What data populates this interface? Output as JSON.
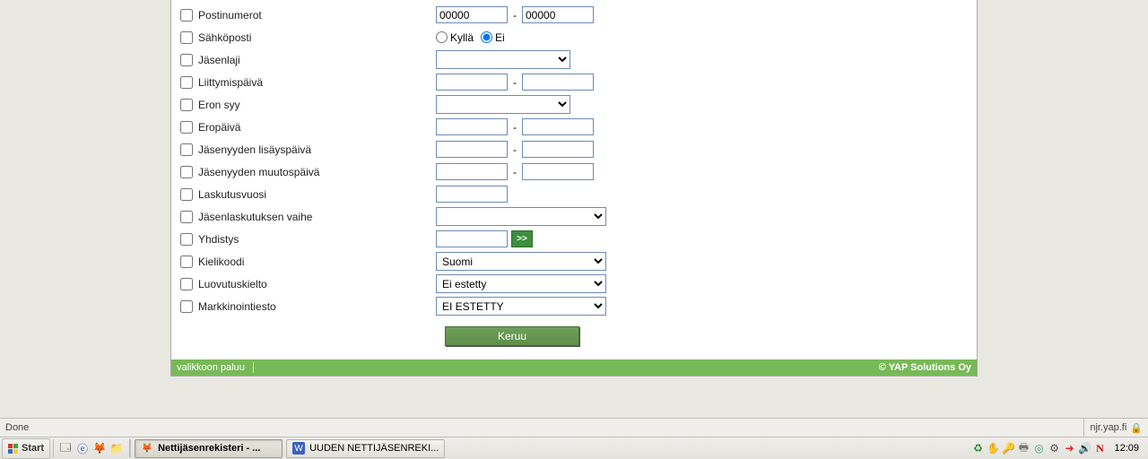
{
  "form": {
    "rows": [
      {
        "key": "postinumerot",
        "label": "Postinumerot",
        "type": "text-range",
        "v1": "00000",
        "v2": "00000"
      },
      {
        "key": "sahkoposti",
        "label": "Sähköposti",
        "type": "radio",
        "opt1": "Kyllä",
        "opt2": "Ei",
        "selected": 2
      },
      {
        "key": "jasenlaji",
        "label": "Jäsenlaji",
        "type": "select",
        "value": ""
      },
      {
        "key": "liittymispaiva",
        "label": "Liittymispäivä",
        "type": "text-range",
        "v1": "",
        "v2": ""
      },
      {
        "key": "eronsyy",
        "label": "Eron syy",
        "type": "select-narrow",
        "value": ""
      },
      {
        "key": "eropaiva",
        "label": "Eropäivä",
        "type": "text-range",
        "v1": "",
        "v2": ""
      },
      {
        "key": "lisayspaiva",
        "label": "Jäsenyyden lisäyspäivä",
        "type": "text-range",
        "v1": "",
        "v2": ""
      },
      {
        "key": "muutospaiva",
        "label": "Jäsenyyden muutospäivä",
        "type": "text-range",
        "v1": "",
        "v2": ""
      },
      {
        "key": "laskutusvuosi",
        "label": "Laskutusvuosi",
        "type": "text-single",
        "v1": ""
      },
      {
        "key": "laskvaihe",
        "label": "Jäsenlaskutuksen vaihe",
        "type": "select-wide",
        "value": ""
      },
      {
        "key": "yhdistys",
        "label": "Yhdistys",
        "type": "text-go",
        "v1": "",
        "go": ">>"
      },
      {
        "key": "kielikoodi",
        "label": "Kielikoodi",
        "type": "select-wide",
        "value": "Suomi"
      },
      {
        "key": "luovutuskielto",
        "label": "Luovutuskielto",
        "type": "select-wide",
        "value": "Ei estetty"
      },
      {
        "key": "markkinointi",
        "label": "Markkinointiesto",
        "type": "select-wide",
        "value": "EI ESTETTY"
      }
    ],
    "run_label": "Keruu"
  },
  "footer": {
    "back_label": "valikkoon paluu",
    "copyright": "© YAP Solutions Oy"
  },
  "status": {
    "text": "Done",
    "domain": "njr.yap.fi"
  },
  "taskbar": {
    "start": "Start",
    "tasks": [
      {
        "label": "Nettijäsenrekisteri - ...",
        "active": true,
        "app": "ff"
      },
      {
        "label": "UUDEN NETTIJÄSENREKI...",
        "active": false,
        "app": "word"
      }
    ],
    "clock": "12:09"
  }
}
